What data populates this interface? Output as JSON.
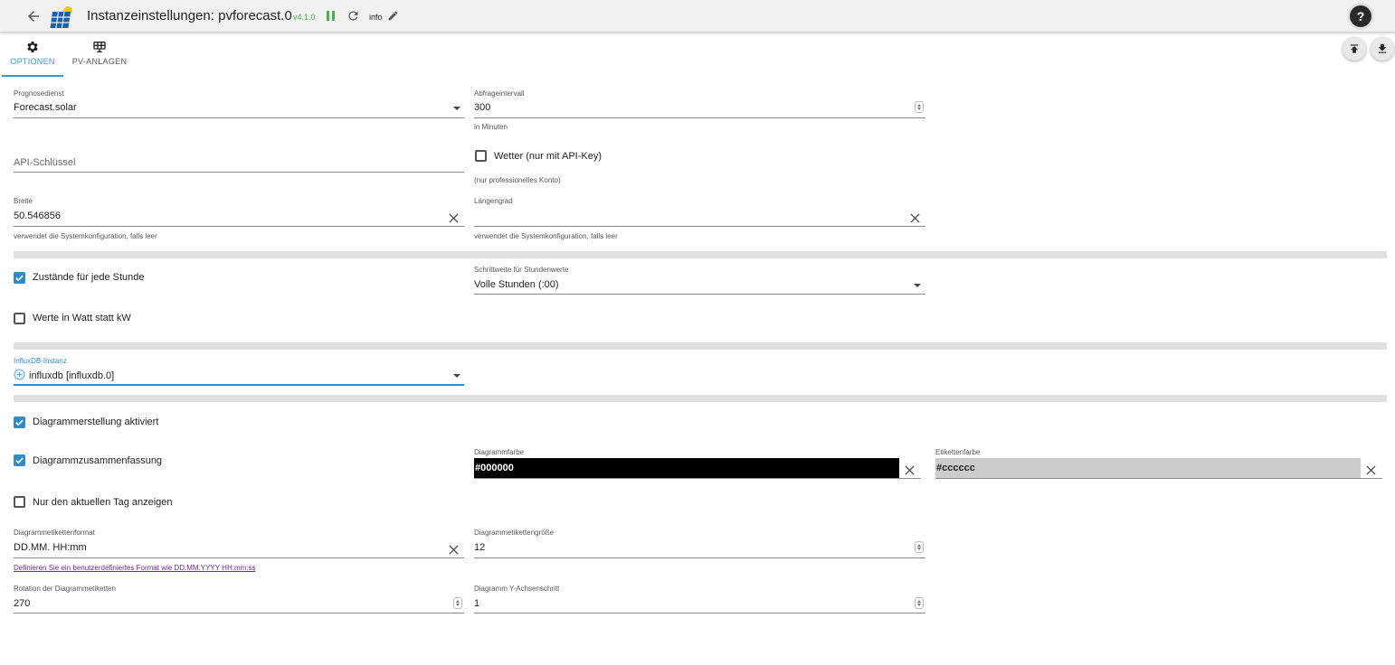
{
  "header": {
    "title": "Instanzeinstellungen: pvforecast.0",
    "version": "v4.1.0",
    "log_level": "info",
    "help_label": "?"
  },
  "tabs": [
    {
      "label": "OPTIONEN",
      "icon": "gear-icon",
      "active": true
    },
    {
      "label": "PV-ANLAGEN",
      "icon": "solar-panel-icon",
      "active": false
    }
  ],
  "form": {
    "prognosedienst": {
      "label": "Prognosedienst",
      "value": "Forecast.solar"
    },
    "abfrageintervall": {
      "label": "Abfrageintervall",
      "value": "300",
      "help": "in Minuten"
    },
    "api_key": {
      "placeholder": "API-Schlüssel"
    },
    "wetter": {
      "label": "Wetter (nur mit API-Key)",
      "help": "(nur professionelles Konto)",
      "checked": false
    },
    "breite": {
      "label": "Breite",
      "value": "50.546856",
      "help": "verwendet die Systemkonfiguration, falls leer"
    },
    "laengengrad": {
      "label": "Längengrad",
      "value": "",
      "help": "verwendet die Systemkonfiguration, falls leer"
    },
    "zustaende": {
      "label": "Zustände für jede Stunde",
      "checked": true
    },
    "schrittweite": {
      "label": "Schrittweite für Stundenwerte",
      "value": "Volle Stunden (:00)"
    },
    "watt": {
      "label": "Werte in Watt statt kW",
      "checked": false
    },
    "influx": {
      "label": "InfluxDB-Instanz",
      "value": "influxdb [influxdb.0]"
    },
    "diagramm_aktiv": {
      "label": "Diagrammerstellung aktiviert",
      "checked": true
    },
    "diagramm_zusammenfassung": {
      "label": "Diagrammzusammenfassung",
      "checked": true
    },
    "diagrammfarbe": {
      "label": "Diagrammfarbe",
      "value": "#000000"
    },
    "etikettenfarbe": {
      "label": "Etikettenfarbe",
      "value": "#cccccc"
    },
    "nur_tag": {
      "label": "Nur den aktuellen Tag anzeigen",
      "checked": false
    },
    "etikettenformat": {
      "label": "Diagrammetikettenformat",
      "value": "DD.MM. HH:mm",
      "link": "Definieren Sie ein benutzerdefiniertes Format wie DD.MM.YYYY HH:mm:ss"
    },
    "etikettengroesse": {
      "label": "Diagrammetikettengröße",
      "value": "12"
    },
    "rotation": {
      "label": "Rotation der Diagrammetiketten",
      "value": "270"
    },
    "y_achsenschritt": {
      "label": "Diagramm Y-Achsenschritt",
      "value": "1"
    }
  },
  "colors": {
    "accent": "#2f8bc7",
    "version_green": "#4caf50",
    "diagram_color": "#000000",
    "label_color": "#cccccc"
  }
}
